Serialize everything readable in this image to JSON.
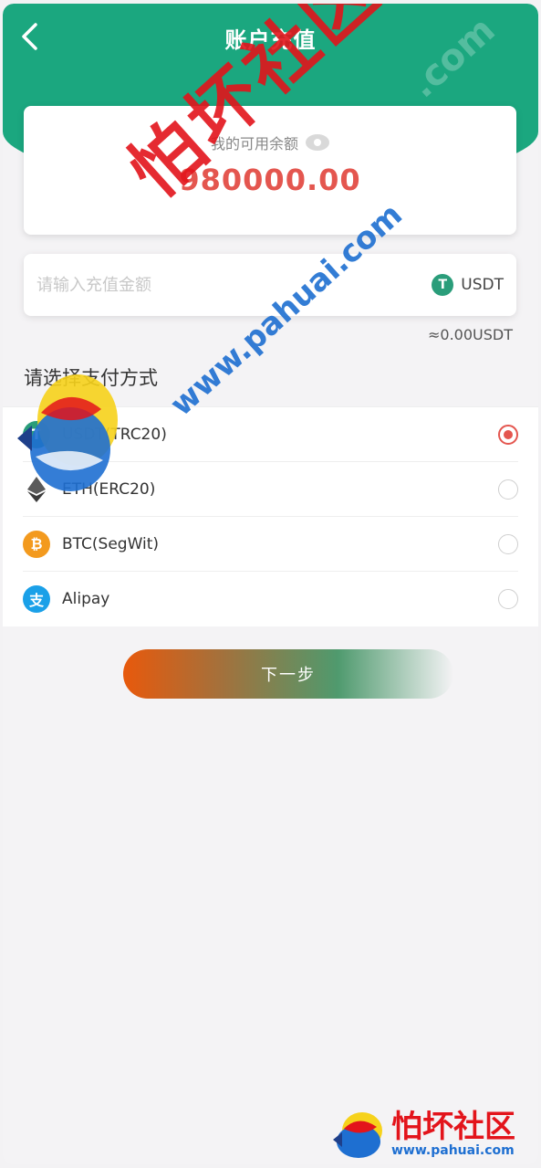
{
  "header": {
    "title": "账户充值",
    "back_icon": "chevron-left-icon",
    "color": "#1ba77f"
  },
  "balance": {
    "label": "我的可用余额",
    "value": "980000.00",
    "value_color": "#e4564f"
  },
  "amount": {
    "placeholder": "请输入充值金额",
    "value": "",
    "currency": "USDT",
    "approx": "≈0.00USDT"
  },
  "payment": {
    "section_title": "请选择支付方式",
    "methods": [
      {
        "label": "USDT(TRC20)",
        "icon": "tether-icon",
        "color": "#2a9d7a",
        "selected": true
      },
      {
        "label": "ETH(ERC20)",
        "icon": "ethereum-icon",
        "color": "#5a5a5a",
        "selected": false
      },
      {
        "label": "BTC(SegWit)",
        "icon": "bitcoin-icon",
        "color": "#f39a1e",
        "selected": false
      },
      {
        "label": "Alipay",
        "icon": "alipay-icon",
        "color": "#1aa0e8",
        "selected": false
      }
    ]
  },
  "actions": {
    "next_label": "下一步"
  },
  "watermark": {
    "brand": "怕坏社区",
    "url": "www.pahuai.com",
    "footer_brand": "怕坏社区",
    "footer_url": "www.pahuai.com",
    "top_right": ".com"
  }
}
